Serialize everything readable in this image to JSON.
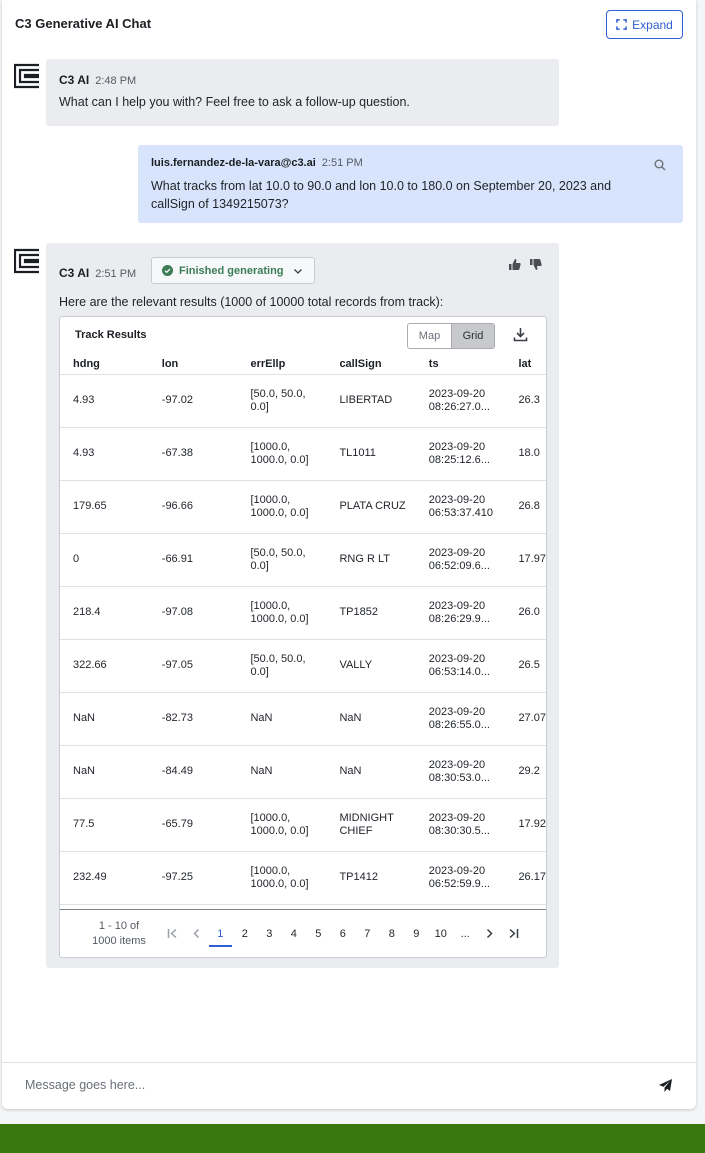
{
  "header": {
    "title": "C3 Generative AI Chat",
    "expand_label": "Expand"
  },
  "messages": [
    {
      "sender": "C3 AI",
      "time": "2:48 PM",
      "text": "What can I help you with? Feel free to ask a follow-up question."
    },
    {
      "sender": "luis.fernandez-de-la-vara@c3.ai",
      "time": "2:51 PM",
      "text": "What tracks from lat 10.0 to 90.0 and lon 10.0 to 180.0 on September 20, 2023 and callSign of 1349215073?"
    },
    {
      "sender": "C3 AI",
      "time": "2:51 PM",
      "status": "Finished generating",
      "text": "Here are the relevant results (1000 of 10000 total records from track):"
    }
  ],
  "grid": {
    "title": "Track Results",
    "view_toggle": [
      "Map",
      "Grid"
    ],
    "selected_view": "Grid",
    "columns": [
      "hdng",
      "lon",
      "errEllp",
      "callSign",
      "ts",
      "lat"
    ],
    "rows": [
      [
        "4.93",
        "-97.02",
        "[50.0, 50.0, 0.0]",
        "LIBERTAD",
        "2023-09-20 08:26:27.0...",
        "26.3"
      ],
      [
        "4.93",
        "-67.38",
        "[1000.0, 1000.0, 0.0]",
        "TL1011",
        "2023-09-20 08:25:12.6...",
        "18.0"
      ],
      [
        "179.65",
        "-96.66",
        "[1000.0, 1000.0, 0.0]",
        "PLATA CRUZ",
        "2023-09-20 06:53:37.410",
        "26.8"
      ],
      [
        "0",
        "-66.91",
        "[50.0, 50.0, 0.0]",
        "RNG R LT",
        "2023-09-20 06:52:09.6...",
        "17.97"
      ],
      [
        "218.4",
        "-97.08",
        "[1000.0, 1000.0, 0.0]",
        "TP1852",
        "2023-09-20 08:26:29.9...",
        "26.0"
      ],
      [
        "322.66",
        "-97.05",
        "[50.0, 50.0, 0.0]",
        "VALLY",
        "2023-09-20 06:53:14.0...",
        "26.5"
      ],
      [
        "NaN",
        "-82.73",
        "NaN",
        "NaN",
        "2023-09-20 08:26:55.0...",
        "27.07"
      ],
      [
        "NaN",
        "-84.49",
        "NaN",
        "NaN",
        "2023-09-20 08:30:53.0...",
        "29.2"
      ],
      [
        "77.5",
        "-65.79",
        "[1000.0, 1000.0, 0.0]",
        "MIDNIGHT CHIEF",
        "2023-09-20 08:30:30.5...",
        "17.92"
      ],
      [
        "232.49",
        "-97.25",
        "[1000.0, 1000.0, 0.0]",
        "TP1412",
        "2023-09-20 06:52:59.9...",
        "26.17"
      ]
    ],
    "pagination": {
      "info_line1": "1 - 10 of",
      "info_line2": "1000 items",
      "pages": [
        "1",
        "2",
        "3",
        "4",
        "5",
        "6",
        "7",
        "8",
        "9",
        "10",
        "..."
      ],
      "current_page": "1"
    }
  },
  "composer": {
    "placeholder": "Message goes here..."
  },
  "colors": {
    "accent": "#2f5fd0",
    "ai_bubble": "#ebecef",
    "user_bubble": "#d7e4fb",
    "status_green": "#3c7d57",
    "footer": "#38780f"
  },
  "icons": [
    "c3-logo-icon",
    "expand-icon",
    "search-icon",
    "check-circle-icon",
    "chevron-down-icon",
    "thumbs-up-icon",
    "thumbs-down-icon",
    "download-icon",
    "first-page-icon",
    "prev-page-icon",
    "next-page-icon",
    "last-page-icon",
    "send-icon"
  ]
}
